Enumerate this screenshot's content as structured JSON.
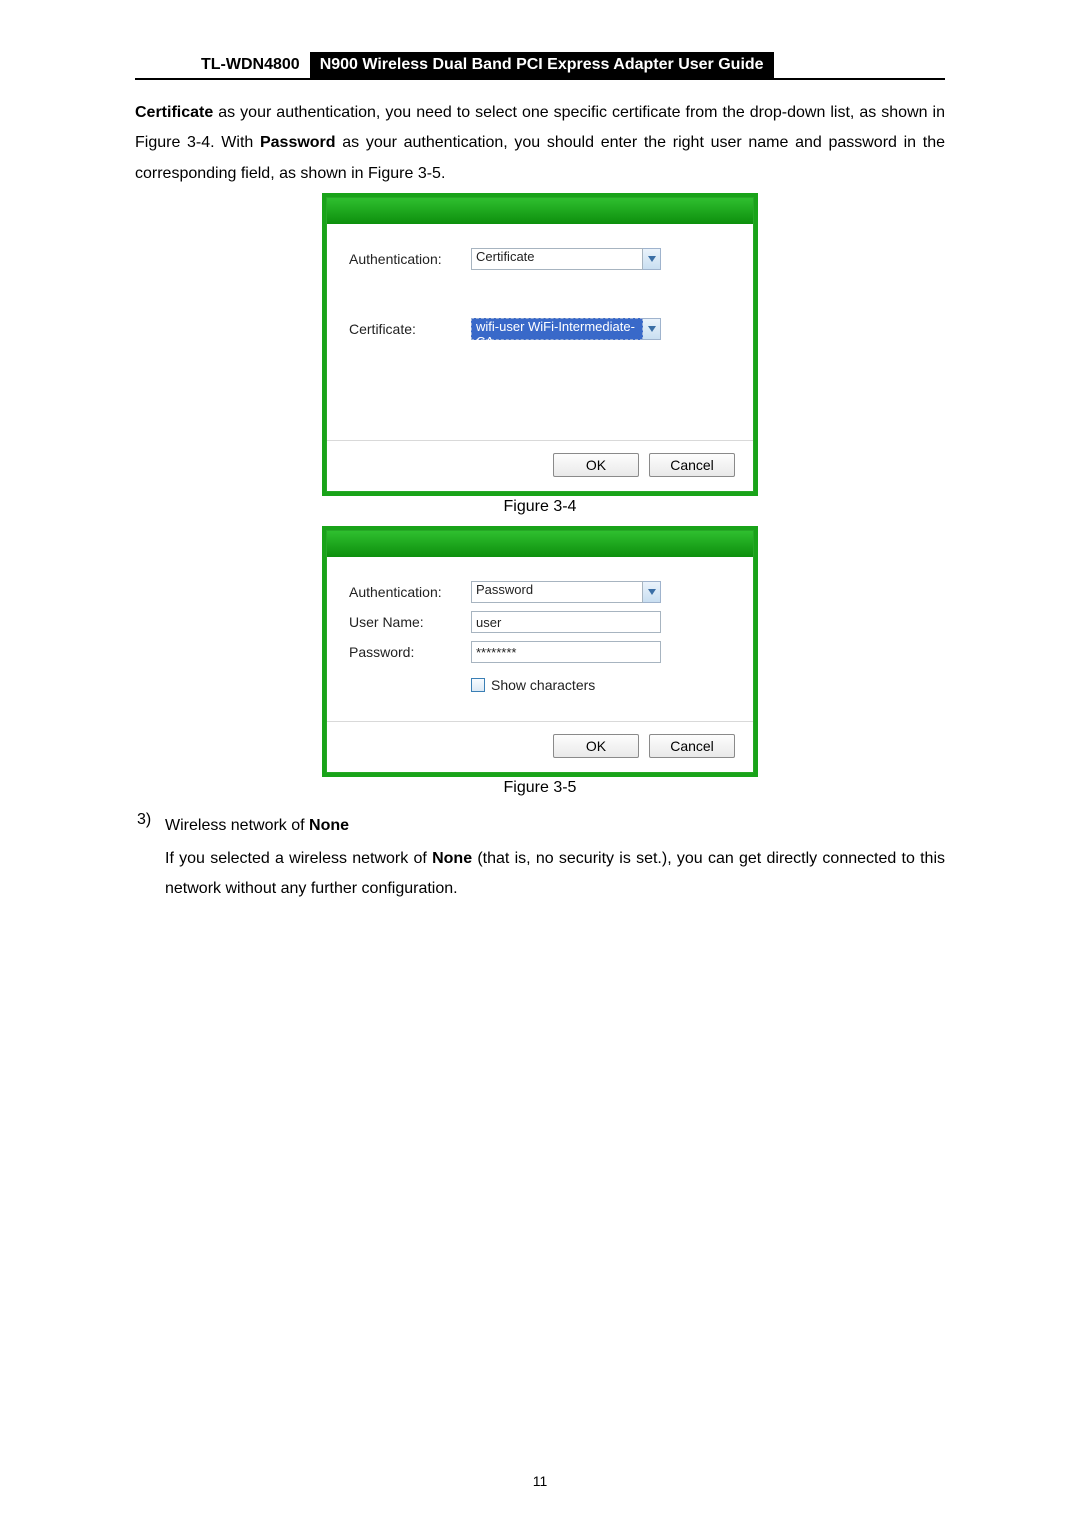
{
  "header": {
    "model": "TL-WDN4800",
    "title": "N900 Wireless Dual Band PCI Express Adapter User Guide"
  },
  "intro": {
    "bold_certificate": "Certificate",
    "part1": " as your authentication, you need to select one specific certificate from the drop-down list, as shown in Figure 3-4. With ",
    "bold_password": "Password",
    "part2": " as your authentication, you should enter the right user name and password in the corresponding field, as shown in Figure 3-5."
  },
  "dialog1": {
    "auth_label": "Authentication:",
    "auth_value": "Certificate",
    "cert_label": "Certificate:",
    "cert_value": "wifi-user  WiFi-Intermediate-CA-",
    "ok": "OK",
    "cancel": "Cancel",
    "caption": "Figure 3-4"
  },
  "dialog2": {
    "auth_label": "Authentication:",
    "auth_value": "Password",
    "user_label": "User Name:",
    "user_value": "user",
    "pass_label": "Password:",
    "pass_value": "********",
    "show_chars": "Show characters",
    "ok": "OK",
    "cancel": "Cancel",
    "caption": "Figure 3-5"
  },
  "section3": {
    "num": "3)",
    "title_pre": "Wireless network of ",
    "title_bold": "None",
    "para_pre": "If you selected a wireless network of ",
    "para_bold": "None",
    "para_post": " (that is, no security is set.), you can get directly connected to this network without any further configuration."
  },
  "page_number": "11"
}
